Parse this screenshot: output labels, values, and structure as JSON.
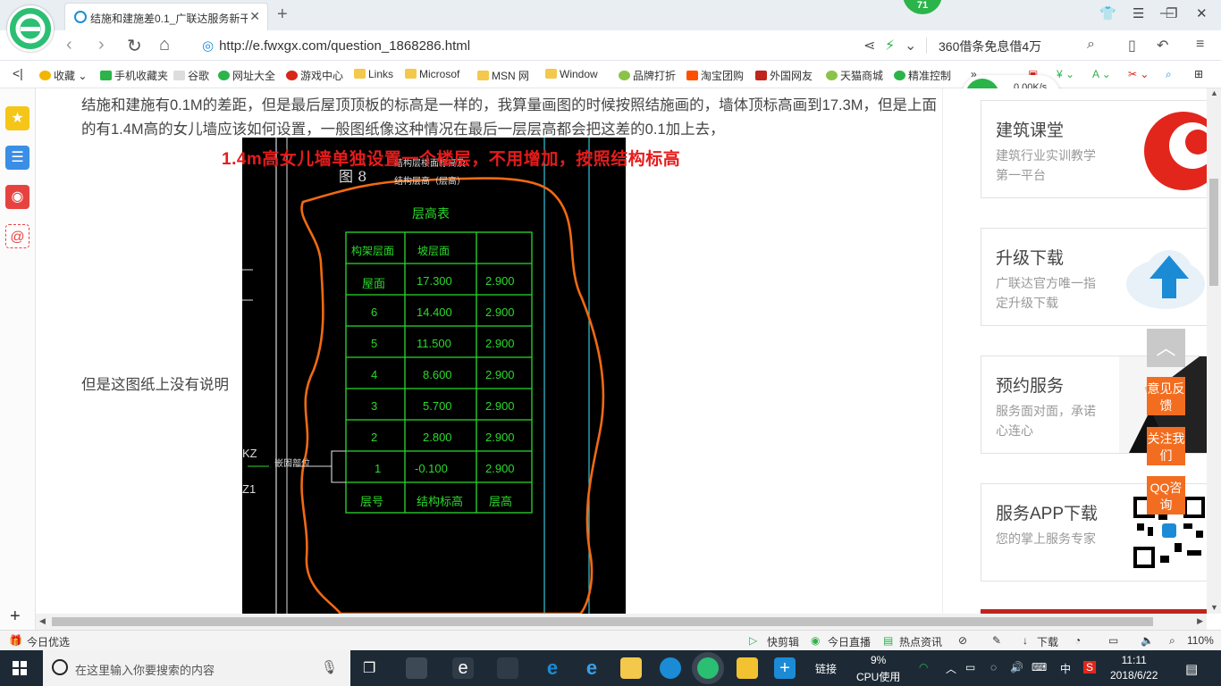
{
  "browser": {
    "tab_title": "结施和建施差0.1_广联达服务新干",
    "notification_count": "71",
    "url": "http://e.fwxgx.com/question_1868286.html",
    "search_text": "360借条免息借4万"
  },
  "bookmarks": [
    "收藏",
    "手机收藏夹",
    "谷歌",
    "网址大全",
    "游戏中心",
    "Links",
    "Microsof",
    "MSN 网",
    "Window",
    "品牌打折",
    "淘宝团购",
    "外国网友",
    "天猫商城",
    "精准控制"
  ],
  "netspeed": {
    "speed": "0.00K/s",
    "count": "0"
  },
  "article": {
    "paragraph": "结施和建施有0.1M的差距，但是最后屋顶顶板的标高是一样的，我算量画图的时候按照结施画的，墙体顶标高画到17.3M，但是上面的有1.4M高的女儿墙应该如何设置，一般图纸像这种情况在最后一层层高都会把这差的0.1加上去，",
    "note": "但是这图纸上没有说明",
    "annotation": "1.4m高女儿墙单独设置一个楼层，不用增加，按照结构标高"
  },
  "cad": {
    "fig_label": "图 8",
    "header_line1": "结构层楼面标高及",
    "header_line2": "结构层高（层高）",
    "table_title": "层高表",
    "col_headers": [
      "构架层面",
      "坡层面",
      ""
    ],
    "rows": [
      {
        "floor": "屋面",
        "elev": "17.300",
        "height": "2.900"
      },
      {
        "floor": "6",
        "elev": "14.400",
        "height": "2.900"
      },
      {
        "floor": "5",
        "elev": "11.500",
        "height": "2.900"
      },
      {
        "floor": "4",
        "elev": "8.600",
        "height": "2.900"
      },
      {
        "floor": "3",
        "elev": "5.700",
        "height": "2.900"
      },
      {
        "floor": "2",
        "elev": "2.800",
        "height": "2.900"
      },
      {
        "floor": "1",
        "elev": "-0.100",
        "height": "2.900"
      }
    ],
    "footer": [
      "层号",
      "结构标高",
      "层高"
    ],
    "side_label": "嵌固部位",
    "left_marks": [
      "KZ",
      "Z1"
    ]
  },
  "sidebar_cards": [
    {
      "title": "建筑课堂",
      "sub": "建筑行业实训教学第一平台"
    },
    {
      "title": "升级下载",
      "sub": "广联达官方唯一指定升级下载"
    },
    {
      "title": "预约服务",
      "sub": "服务面对面，承诺心连心"
    },
    {
      "title": "服务APP下载",
      "sub": "您的掌上服务专家"
    }
  ],
  "float_buttons": [
    "意见反馈",
    "关注我们",
    "QQ咨询"
  ],
  "statusbar": {
    "left": "今日优选",
    "items": [
      "快剪辑",
      "今日直播",
      "热点资讯",
      "下载"
    ],
    "zoom": "110%"
  },
  "taskbar": {
    "search_placeholder": "在这里输入你要搜索的内容",
    "link_label": "链接",
    "cpu_percent": "9%",
    "cpu_label": "CPU使用",
    "ime": "中",
    "time": "11:11",
    "date": "2018/6/22"
  }
}
